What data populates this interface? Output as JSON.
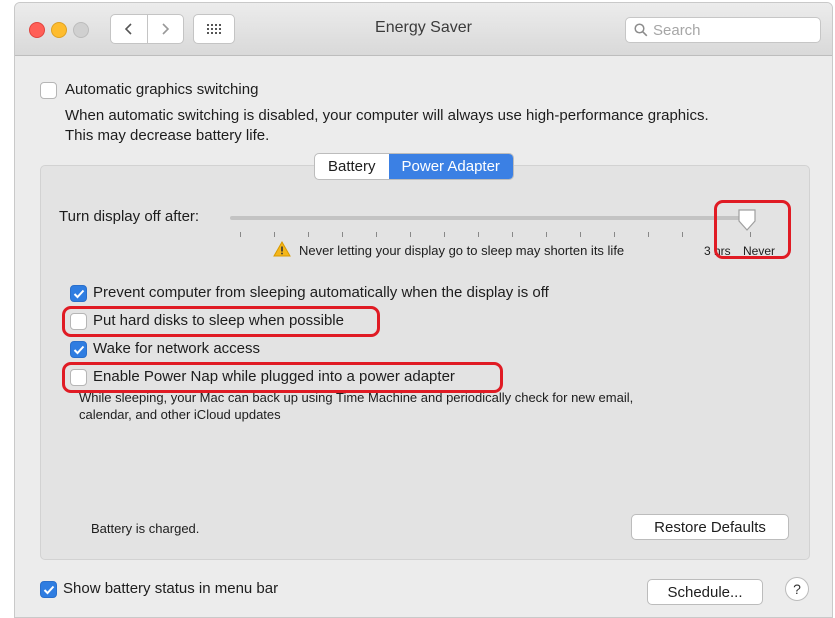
{
  "window": {
    "title": "Energy Saver"
  },
  "search": {
    "placeholder": "Search"
  },
  "graphics": {
    "label": "Automatic graphics switching",
    "checked": false,
    "description_line1": "When automatic switching is disabled, your computer will always use high-performance graphics.",
    "description_line2": "This may decrease battery life."
  },
  "tabs": [
    {
      "label": "Battery",
      "active": false
    },
    {
      "label": "Power Adapter",
      "active": true
    }
  ],
  "slider": {
    "label": "Turn display off after:",
    "warning": "Never letting your display go to sleep may shorten its life",
    "hrs_label": "3 hrs",
    "never_label": "Never",
    "value": "Never"
  },
  "options": [
    {
      "label": "Prevent computer from sleeping automatically when the display is off",
      "checked": true
    },
    {
      "label": "Put hard disks to sleep when possible",
      "checked": false
    },
    {
      "label": "Wake for network access",
      "checked": true
    },
    {
      "label": "Enable Power Nap while plugged into a power adapter",
      "checked": false
    }
  ],
  "power_nap_description": {
    "line1": "While sleeping, your Mac can back up using Time Machine and periodically check for new email,",
    "line2": "calendar, and other iCloud updates"
  },
  "status": "Battery is charged.",
  "restore_button": "Restore Defaults",
  "show_battery": {
    "label": "Show battery status in menu bar",
    "checked": true
  },
  "schedule_button": "Schedule...",
  "help_label": "?",
  "colors": {
    "accent": "#3b80e4",
    "highlight": "#e01b24"
  }
}
